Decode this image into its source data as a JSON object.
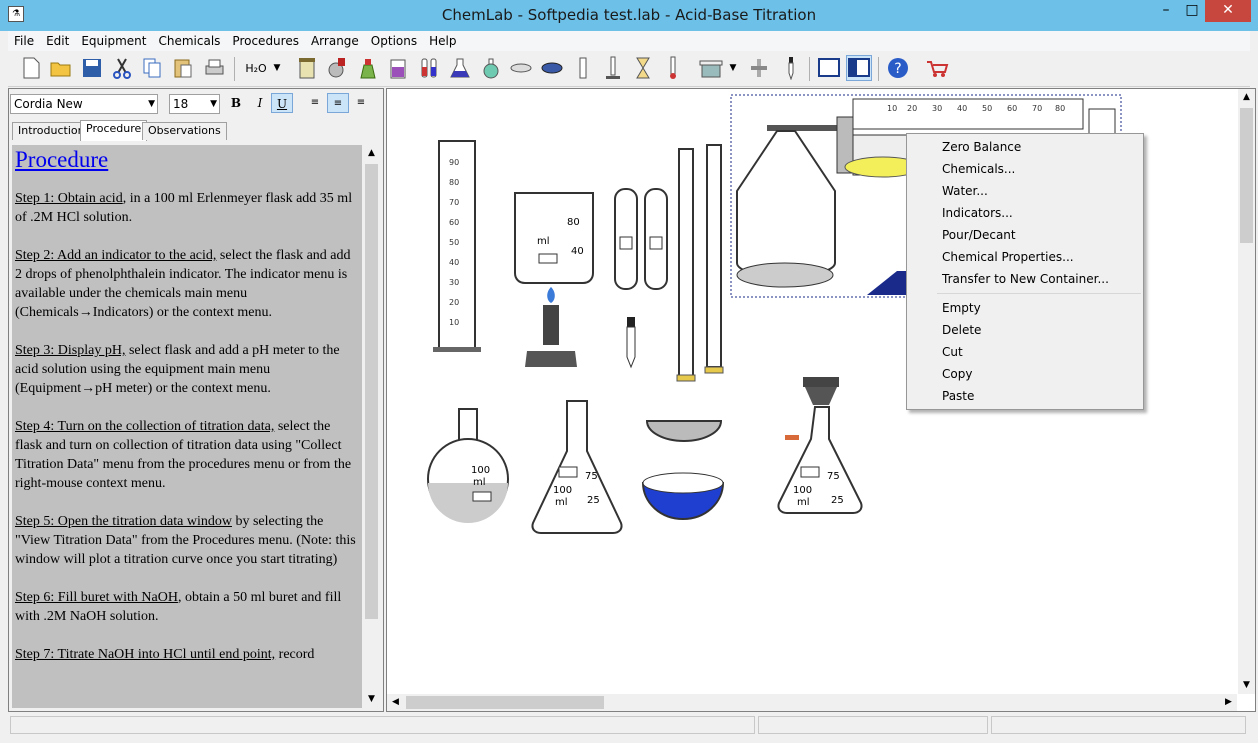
{
  "window": {
    "title": "ChemLab - Softpedia test.lab - Acid-Base Titration"
  },
  "menu": [
    "File",
    "Edit",
    "Equipment",
    "Chemicals",
    "Procedures",
    "Arrange",
    "Options",
    "Help"
  ],
  "format": {
    "font": "Cordia New",
    "size": "18",
    "bold": "B",
    "italic": "I",
    "underline": "U"
  },
  "tabs": [
    "Introduction",
    "Procedure",
    "Observations"
  ],
  "doc": {
    "heading": "Procedure",
    "steps": [
      {
        "title": "Step 1: Obtain acid",
        "text": ", in a 100 ml Erlenmeyer flask add 35 ml of  .2M  HCl solution."
      },
      {
        "title": "Step 2: Add an indicator to the acid,",
        "text": " select the flask and add 2 drops of phenolphthalein indicator. The indicator menu is available under the chemicals main menu (Chemicals→Indicators) or the context menu."
      },
      {
        "title": "Step 3:  Display pH,",
        "text": " select flask and add a pH meter to the acid solution using the equipment main menu (Equipment→pH meter) or the context menu."
      },
      {
        "title": "Step 4:  Turn on the collection of titration data,",
        "text": " select the flask and turn on collection of titration data using \"Collect Titration Data\" menu from the procedures menu or from the right-mouse context menu."
      },
      {
        "title": "Step 5: Open the titration data window",
        "text": " by selecting the \"View Titration Data\" from the Procedures menu. (Note: this window will plot a titration curve once you start titrating)"
      },
      {
        "title": "Step 6: Fill buret with NaOH",
        "text": ", obtain a 50 ml buret and fill with .2M NaOH solution."
      },
      {
        "title": "Step 7: Titrate NaOH into HCl until end point,",
        "text": " record"
      }
    ]
  },
  "context": [
    "Zero Balance",
    "Chemicals...",
    "Water...",
    "Indicators...",
    "Pour/Decant",
    "Chemical Properties...",
    "Transfer to New Container...",
    "Empty",
    "Delete",
    "Cut",
    "Copy",
    "Paste"
  ]
}
